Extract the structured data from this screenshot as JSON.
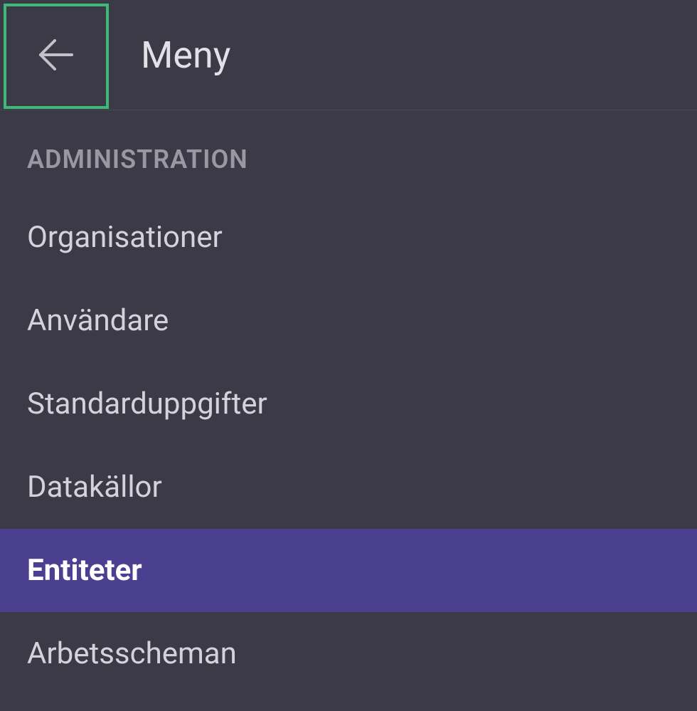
{
  "header": {
    "title": "Meny"
  },
  "section": {
    "title": "ADMINISTRATION"
  },
  "menu": {
    "items": [
      {
        "label": "Organisationer",
        "selected": false
      },
      {
        "label": "Användare",
        "selected": false
      },
      {
        "label": "Standarduppgifter",
        "selected": false
      },
      {
        "label": "Datakällor",
        "selected": false
      },
      {
        "label": "Entiteter",
        "selected": true
      },
      {
        "label": "Arbetsscheman",
        "selected": false
      }
    ]
  }
}
